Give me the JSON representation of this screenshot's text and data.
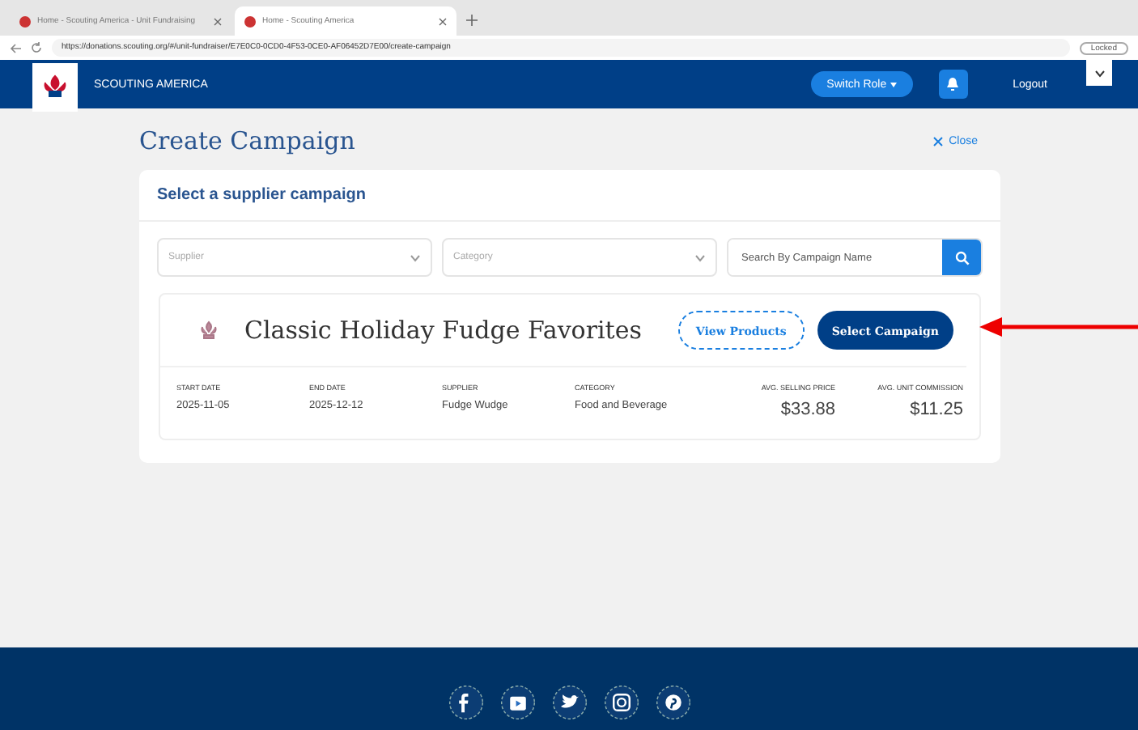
{
  "browser": {
    "tabs": [
      {
        "title": "Home - Scouting America - Unit Fundraising",
        "selected": false
      },
      {
        "title": "Home - Scouting America",
        "selected": true
      }
    ],
    "url": "https://donations.scouting.org/#/unit-fundraiser/E7E0C0-0CD0-4F53-0CE0-AF06452D7E00/create-campaign",
    "profile": "Locked"
  },
  "header": {
    "brand": "SCOUTING AMERICA",
    "switch_role": "Switch Role",
    "logout": "Logout"
  },
  "page": {
    "title": "Create Campaign",
    "close": "Close",
    "card_title": "Select a supplier campaign",
    "filters": {
      "supplier": "Supplier",
      "category": "Category",
      "search_placeholder": "Search By Campaign Name"
    },
    "campaign": {
      "name": "Classic Holiday Fudge Favorites",
      "view_products": "View Products",
      "select": "Select Campaign",
      "details": [
        {
          "label": "START DATE",
          "value": "2025-11-05",
          "kind": "text"
        },
        {
          "label": "END DATE",
          "value": "2025-12-12",
          "kind": "text"
        },
        {
          "label": "SUPPLIER",
          "value": "Fudge Wudge",
          "kind": "text"
        },
        {
          "label": "CATEGORY",
          "value": "Food and Beverage",
          "kind": "text"
        },
        {
          "label": "AVG. SELLING PRICE",
          "value": "$33.88",
          "kind": "money"
        },
        {
          "label": "AVG. UNIT COMMISSION",
          "value": "$11.25",
          "kind": "money"
        }
      ]
    }
  },
  "footer": {
    "social": [
      {
        "kind": "facebook"
      },
      {
        "kind": "youtube"
      },
      {
        "kind": "twitter"
      },
      {
        "kind": "instagram"
      },
      {
        "kind": "pinterest"
      }
    ]
  }
}
